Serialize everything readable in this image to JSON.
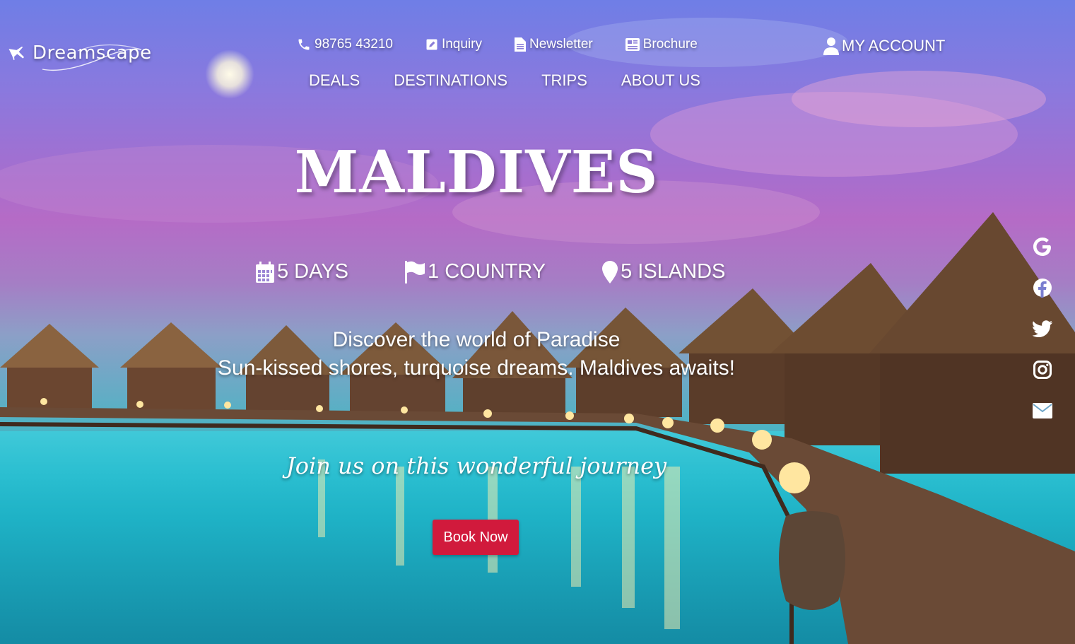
{
  "brand": {
    "name": "Dreamscape"
  },
  "topbar": {
    "phone": "98765 43210",
    "inquiry": "Inquiry",
    "newsletter": "Newsletter",
    "brochure": "Brochure"
  },
  "nav": {
    "items": [
      "DEALS",
      "DESTINATIONS",
      "TRIPS",
      "ABOUT US"
    ]
  },
  "account": {
    "label": "MY ACCOUNT"
  },
  "hero": {
    "title": "MALDIVES",
    "stats": [
      {
        "icon": "calendar-icon",
        "label": "5 DAYS"
      },
      {
        "icon": "flag-icon",
        "label": "1 COUNTRY"
      },
      {
        "icon": "map-pin-icon",
        "label": "5 ISLANDS"
      }
    ],
    "tagline_1": "Discover the world of Paradise",
    "tagline_2": "Sun-kissed shores, turquoise dreams. Maldives awaits!",
    "script_line": "Join us on this wonderful journey",
    "cta": "Book Now"
  },
  "social": [
    "google-icon",
    "facebook-icon",
    "twitter-icon",
    "instagram-icon",
    "mail-icon"
  ],
  "colors": {
    "cta": "#d11a3c",
    "text": "#ffffff"
  }
}
